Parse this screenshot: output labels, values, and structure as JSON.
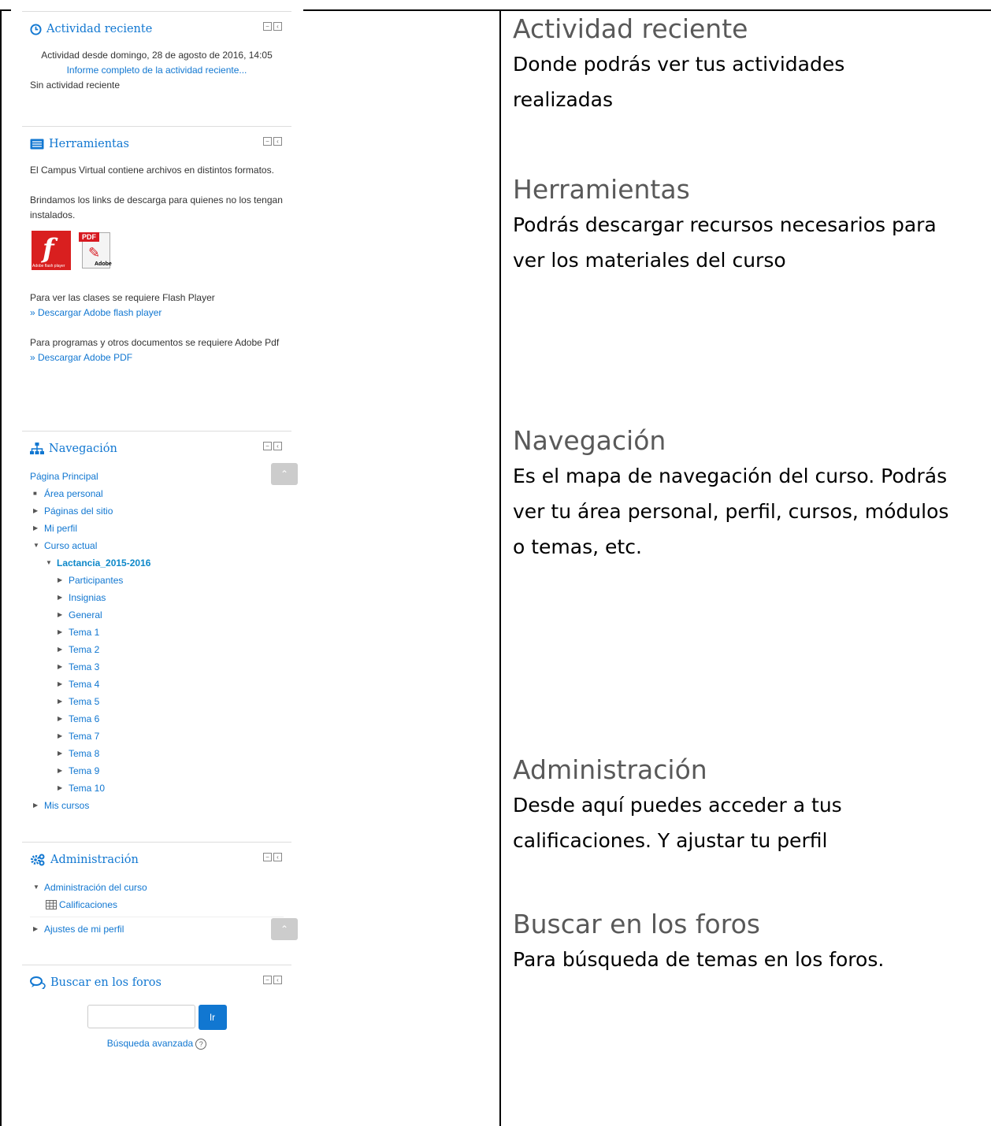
{
  "left": {
    "actividad": {
      "title": "Actividad reciente",
      "since": "Actividad desde domingo, 28 de agosto de 2016, 14:05",
      "report_link": "Informe completo de la actividad reciente...",
      "empty": "Sin actividad reciente"
    },
    "herramientas": {
      "title": "Herramientas",
      "p1": "El Campus Virtual contiene archivos en distintos formatos.",
      "p2": "Brindamos los links de descarga para quienes no los tengan instalados.",
      "flash_caption": "Adobe flash player",
      "pdf_tag": "PDF",
      "pdf_caption": "Adobe",
      "flash_text": "Para ver las clases se requiere Flash Player",
      "flash_link": "» Descargar Adobe flash player",
      "pdf_text": "Para programas y otros documentos se requiere Adobe Pdf",
      "pdf_link": "» Descargar Adobe PDF"
    },
    "navegacion": {
      "title": "Navegación",
      "home": "Página Principal",
      "area_personal": "Área personal",
      "paginas_sitio": "Páginas del sitio",
      "mi_perfil": "Mi perfil",
      "curso_actual": "Curso actual",
      "curso": "Lactancia_2015-2016",
      "items": [
        "Participantes",
        "Insignias",
        "General",
        "Tema 1",
        "Tema 2",
        "Tema 3",
        "Tema 4",
        "Tema 5",
        "Tema 6",
        "Tema 7",
        "Tema 8",
        "Tema 9",
        "Tema 10"
      ],
      "mis_cursos": "Mis cursos"
    },
    "administracion": {
      "title": "Administración",
      "admin_curso": "Administración del curso",
      "calificaciones": "Calificaciones",
      "ajustes": "Ajustes de mi perfil"
    },
    "buscar": {
      "title": "Buscar en los foros",
      "button": "Ir",
      "advanced": "Búsqueda avanzada"
    }
  },
  "right": {
    "s1": {
      "title": "Actividad reciente",
      "text": "Donde podrás ver tus actividades realizadas"
    },
    "s2": {
      "title": "Herramientas",
      "text": "Podrás descargar recursos necesarios para ver los materiales del curso"
    },
    "s3": {
      "title": "Navegación",
      "text": "Es el mapa de navegación del curso. Podrás ver tu área personal, perfil, cursos, módulos o temas, etc."
    },
    "s4": {
      "title": "Administración",
      "text": "Desde aquí puedes acceder a tus calificaciones. Y ajustar tu perfil"
    },
    "s5": {
      "title": "Buscar en los foros",
      "text": "Para búsqueda de temas en los foros."
    }
  }
}
